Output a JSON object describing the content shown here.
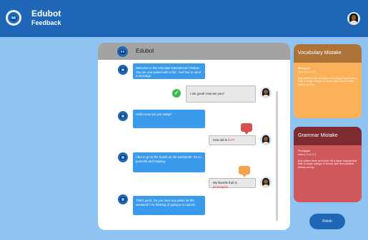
{
  "header": {
    "title": "Edubot",
    "subtitle": "Feedback"
  },
  "chat": {
    "bot_name": "Edubot",
    "messages": [
      {
        "sender": "bot",
        "text": "Welcome to the Articulate Educational Chatbot. You are now paired with a bot - feel free to send a message."
      },
      {
        "sender": "user",
        "text": "I am good! How are you?",
        "feedback": "correct"
      },
      {
        "sender": "bot",
        "text": "Hello! How are you today?"
      },
      {
        "sender": "user",
        "text_before": "How old is ",
        "highlight": "her",
        "text_after": "?",
        "feedback": "grammar"
      },
      {
        "sender": "bot",
        "text": "I like to go to the beach on the weekends. It's so peaceful and relaxing."
      },
      {
        "sender": "user",
        "text_before": "My favorite fruit is ",
        "highlight": "pinneapple",
        "text_after": "",
        "feedback": "vocabulary"
      },
      {
        "sender": "bot",
        "text": "That's good. Do you have any plans for the weekend? I'm thinking of going to a concert."
      }
    ],
    "feedback_icon": "...",
    "check_icon": "✓"
  },
  "vocabulary_card": {
    "title": "Vocabulary Mistake",
    "word": "Pineapple",
    "part": "noun [ C or U ]",
    "definition": "(the yellow flesh and juice of) a large tropical fruit with a rough orange or brown skin and pointed leaves on top"
  },
  "grammar_card": {
    "title": "Grammar Mistake",
    "word": "Pineapple",
    "part": "noun [ C or U ]",
    "definition": "(the yellow flesh and juice of) a large tropical fruit with a rough orange or brown skin and pointed leaves on top"
  },
  "finish_label": "Finish",
  "colors": {
    "topbar": "#1f67b6",
    "background": "#8ec3f2",
    "bot_bubble": "#3a9bec",
    "vocab_head": "#ad7339",
    "vocab_body": "#fbb158",
    "grammar_head": "#7e2a31",
    "grammar_body": "#cf585c",
    "correct": "#3dbb4f"
  }
}
